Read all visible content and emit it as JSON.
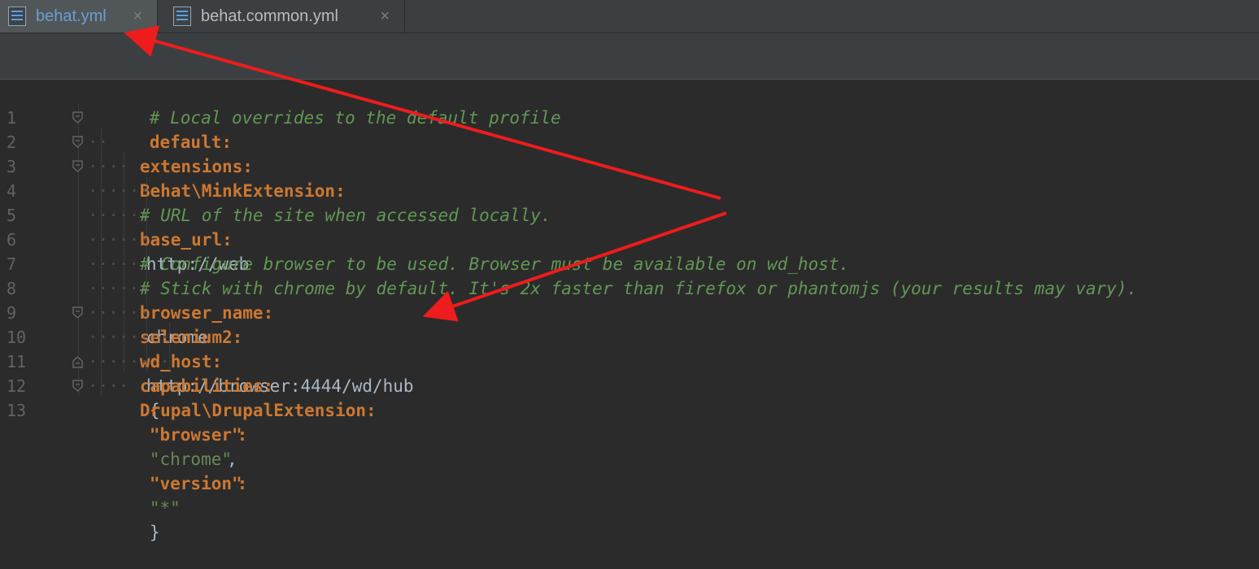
{
  "tabs": [
    {
      "label": "behat.yml",
      "active": true,
      "close": "×"
    },
    {
      "label": "behat.common.yml",
      "active": false,
      "close": "×"
    }
  ],
  "editor": {
    "lines": [
      {
        "num": "1",
        "text": "# Local overrides to the default profile"
      },
      {
        "num": "2",
        "text": "default:"
      },
      {
        "num": "3",
        "text": "extensions:"
      },
      {
        "num": "4",
        "text": "Behat\\MinkExtension:"
      },
      {
        "num": "5",
        "text": "# URL of the site when accessed locally."
      },
      {
        "num": "6",
        "key": "base_url:",
        "value": "http://web"
      },
      {
        "num": "7",
        "text": "# Configure browser to be used. Browser must be available on wd_host."
      },
      {
        "num": "8",
        "text": "# Stick with chrome by default. It's 2x faster than firefox or phantomjs (your results may vary)."
      },
      {
        "num": "9",
        "key": "browser_name:",
        "value": "chrome"
      },
      {
        "num": "10",
        "text": "selenium2:"
      },
      {
        "num": "11",
        "key": "wd_host:",
        "value": "http://browser:4444/wd/hub"
      },
      {
        "num": "12",
        "key": "capabilities:",
        "brace_open": "{",
        "k1": "\"browser\"",
        "colon1": ":",
        "v1": "\"chrome\"",
        "comma": ",",
        "k2": "\"version\"",
        "colon2": ":",
        "v2": "\"*\"",
        "brace_close": "}"
      },
      {
        "num": "13",
        "text": "Drupal\\DrupalExtension:"
      }
    ]
  },
  "colors": {
    "keyword": "#cc7832",
    "comment": "#629755",
    "value": "#a9b7c6",
    "arrow": "#ee1c1c"
  }
}
